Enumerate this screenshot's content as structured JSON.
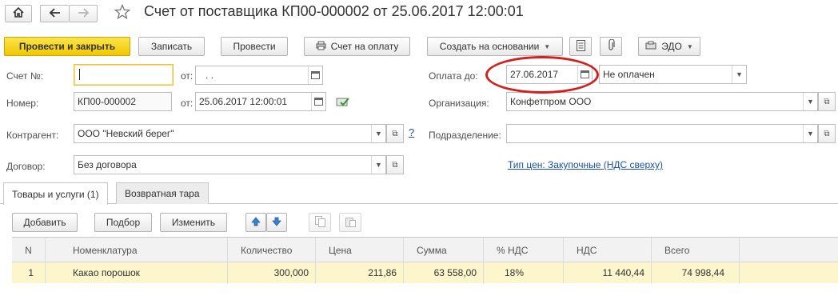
{
  "title": "Счет от поставщика КП00-000002 от 25.06.2017 12:00:01",
  "nav": {
    "home_icon": "home-icon",
    "back_icon": "arrow-left-icon",
    "forward_icon": "arrow-right-icon",
    "star_icon": "star-icon"
  },
  "toolbar": {
    "post_close": "Провести и закрыть",
    "save": "Записать",
    "post": "Провести",
    "invoice_for_payment": "Счет на оплату",
    "create_based_on": "Создать на основании",
    "edo": "ЭДО"
  },
  "form": {
    "invoice_no_label": "Счет №:",
    "invoice_no_value": "",
    "from_label_1": "от:",
    "invoice_date_value": ". .",
    "number_label": "Номер:",
    "number_value": "КП00-000002",
    "from_label_2": "от:",
    "date_value": "25.06.2017 12:00:01",
    "contractor_label": "Контрагент:",
    "contractor_value": "ООО \"Невский берег\"",
    "help_mark": "?",
    "contract_label": "Договор:",
    "contract_value": "Без договора",
    "pay_until_label": "Оплата до:",
    "pay_until_value": "27.06.2017",
    "payment_status": "Не оплачен",
    "org_label": "Организация:",
    "org_value": "Конфетпром ООО",
    "division_label": "Подразделение:",
    "division_value": "",
    "price_type_link": "Тип цен: Закупочные (НДС сверху)"
  },
  "tabs": [
    {
      "label": "Товары и услуги (1)",
      "active": true
    },
    {
      "label": "Возвратная тара",
      "active": false
    }
  ],
  "table_toolbar": {
    "add": "Добавить",
    "pick": "Подбор",
    "edit": "Изменить"
  },
  "table": {
    "columns": [
      "N",
      "Номенклатура",
      "Количество",
      "Цена",
      "Сумма",
      "% НДС",
      "НДС",
      "Всего"
    ],
    "rows": [
      [
        "1",
        "Какао порошок",
        "300,000",
        "211,86",
        "63 558,00",
        "18%",
        "11 440,44",
        "74 998,44"
      ]
    ]
  },
  "colors": {
    "primary_button": "#f4cd14",
    "link": "#1d4fa3",
    "highlight_oval": "#d21f1f",
    "selected_row": "#fdf6cd"
  }
}
